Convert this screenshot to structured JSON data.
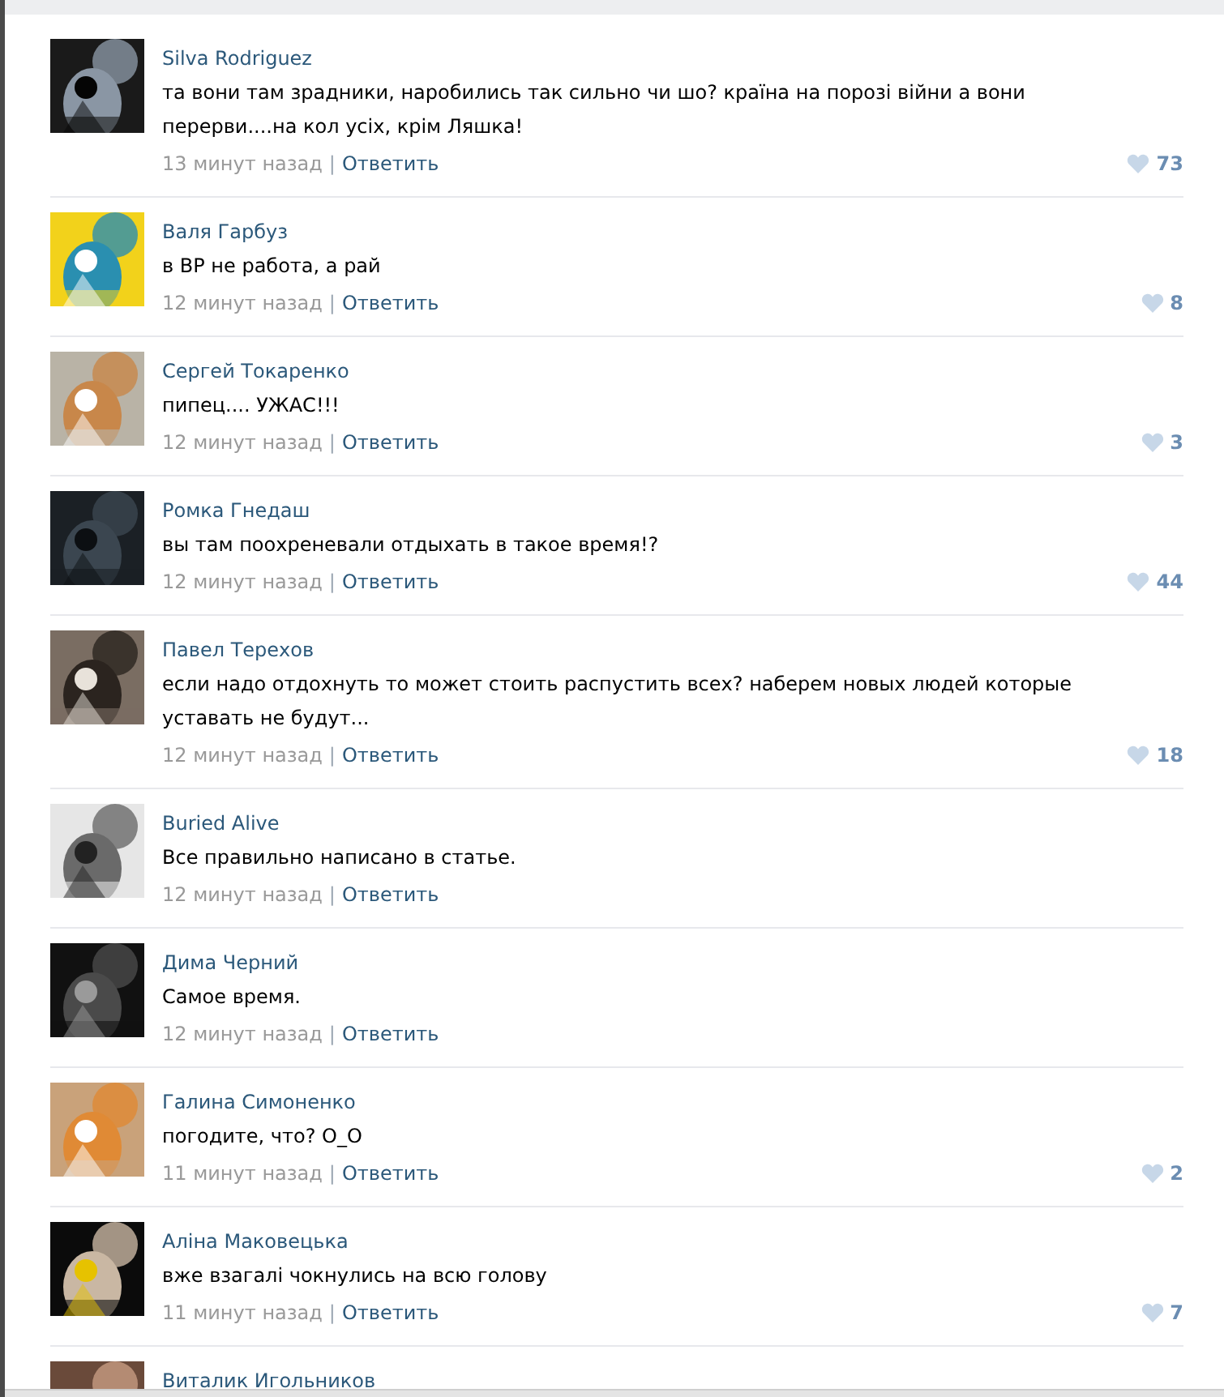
{
  "comments": [
    {
      "author": "Silva Rodriguez",
      "text": "та вони там зрадники, наробились так сильно чи шо? країна на порозі війни а вони перерви....на кол усіх, крім Ляшка!",
      "time": "13 минут назад",
      "separator": "|",
      "reply": "Ответить",
      "likes": "73"
    },
    {
      "author": "Валя Гарбуз",
      "text": "в ВР не работа, а рай",
      "time": "12 минут назад",
      "separator": "|",
      "reply": "Ответить",
      "likes": "8"
    },
    {
      "author": "Сергей Токаренко",
      "text": "пипец.... УЖАС!!!",
      "time": "12 минут назад",
      "separator": "|",
      "reply": "Ответить",
      "likes": "3"
    },
    {
      "author": "Ромка Гнедаш",
      "text": "вы там поохреневали отдыхать в такое время!?",
      "time": "12 минут назад",
      "separator": "|",
      "reply": "Ответить",
      "likes": "44"
    },
    {
      "author": "Павел Терехов",
      "text": "если надо отдохнуть то может стоить распустить всех? наберем новых людей которые уставать не будут...",
      "time": "12 минут назад",
      "separator": "|",
      "reply": "Ответить",
      "likes": "18"
    },
    {
      "author": "Buried Alive",
      "text": "Все правильно написано в статье.",
      "time": "12 минут назад",
      "separator": "|",
      "reply": "Ответить"
    },
    {
      "author": "Дима Черний",
      "text": "Самое время.",
      "time": "12 минут назад",
      "separator": "|",
      "reply": "Ответить"
    },
    {
      "author": "Галина Симоненко",
      "text": "погодите, что? O_O",
      "time": "11 минут назад",
      "separator": "|",
      "reply": "Ответить",
      "likes": "2"
    },
    {
      "author": "Аліна Маковецька",
      "text": "вже взагалі чокнулись на всю голову",
      "time": "11 минут назад",
      "separator": "|",
      "reply": "Ответить",
      "likes": "7"
    },
    {
      "author": "Виталик Игольников"
    }
  ]
}
